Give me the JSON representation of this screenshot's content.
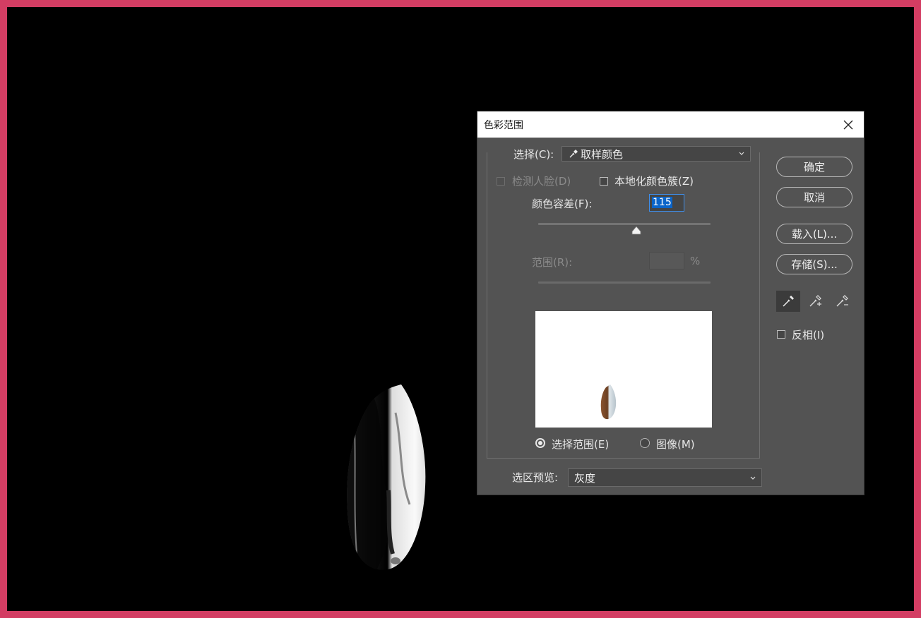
{
  "dialog": {
    "title": "色彩范围",
    "select_label": "选择(C):",
    "select_value": "取样颜色",
    "detect_faces_label": "检测人脸(D)",
    "localized_label": "本地化颜色簇(Z)",
    "fuzziness_label": "颜色容差(F):",
    "fuzziness_value": "115",
    "fuzziness_fraction": 0.57,
    "range_label": "范围(R):",
    "range_value": "",
    "percent": "%",
    "radio_selection_label": "选择范围(E)",
    "radio_image_label": "图像(M)",
    "radio_selected": "selection",
    "preview_label": "选区预览:",
    "preview_value": "灰度",
    "invert_label": "反相(I)"
  },
  "buttons": {
    "ok": "确定",
    "cancel": "取消",
    "load": "载入(L)...",
    "save": "存储(S)..."
  },
  "eyedroppers": [
    "eyedropper-icon",
    "eyedropper-plus-icon",
    "eyedropper-minus-icon"
  ],
  "colors": {
    "frame": "#d33d63",
    "canvas": "#000000",
    "dialog": "#535353",
    "accent": "#0a64c8"
  }
}
